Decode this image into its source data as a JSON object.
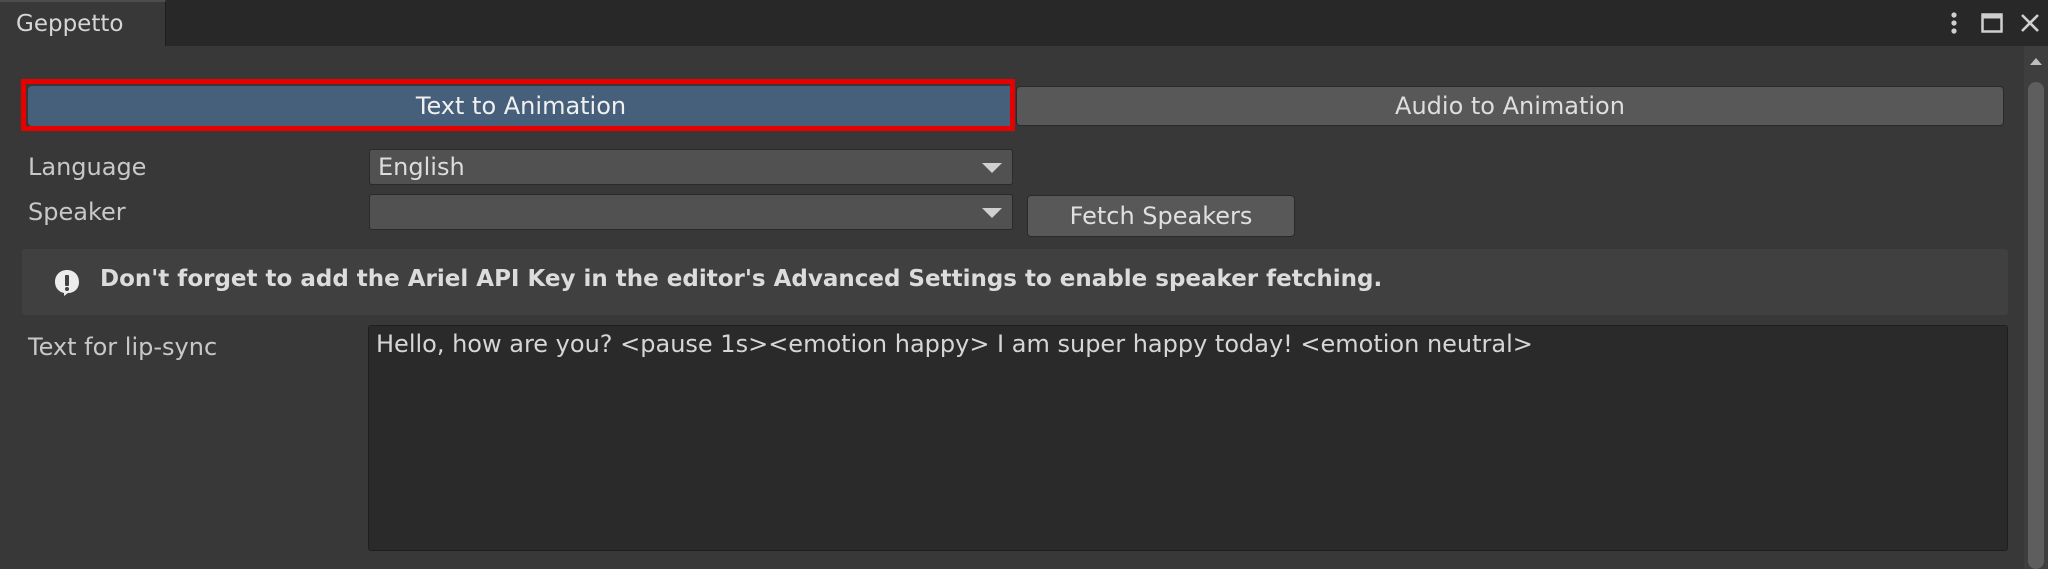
{
  "window": {
    "tab_title": "Geppetto",
    "controls": [
      "more-vertical-icon",
      "maximize-icon",
      "close-icon"
    ]
  },
  "modes": {
    "text_to_animation": "Text to Animation",
    "audio_to_animation": "Audio to Animation",
    "active": "Text to Animation"
  },
  "language": {
    "label": "Language",
    "value": "English"
  },
  "speaker": {
    "label": "Speaker",
    "value": "",
    "fetch_button": "Fetch Speakers"
  },
  "help": {
    "icon": "exclamation-info-icon",
    "message": "Don't forget to add the Ariel API Key in the editor's Advanced Settings to enable speaker fetching."
  },
  "lipsync": {
    "label": "Text for lip-sync",
    "value": "Hello, how are you? <pause 1s><emotion happy> I am super happy today! <emotion neutral>"
  },
  "colors": {
    "background": "#383838",
    "active_tab": "#46607c",
    "highlight": "#e60000"
  }
}
